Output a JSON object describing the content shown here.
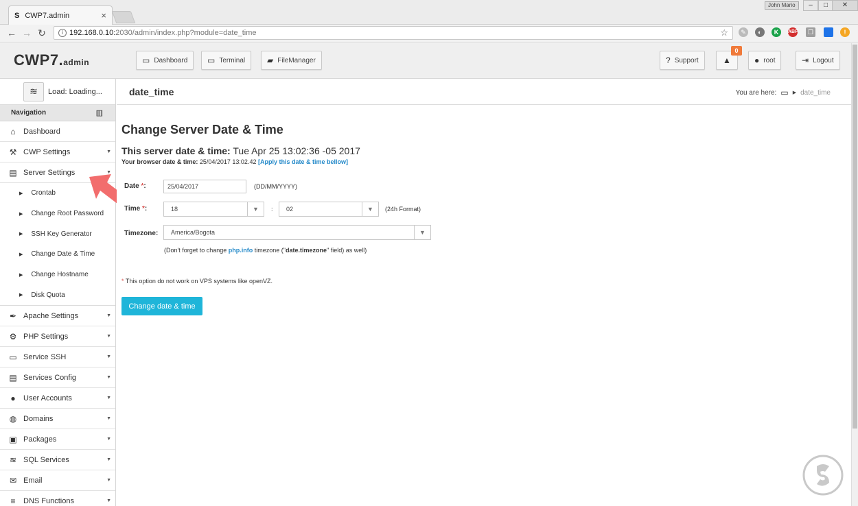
{
  "browser": {
    "tab_favicon": "S",
    "tab_title": "CWP7.admin",
    "tab_close": "×",
    "user_badge": "John Mario",
    "url_host": "192.168.0.10:",
    "url_path": "2030/admin/index.php?module=date_time",
    "window_controls": [
      "–",
      "□",
      "✕"
    ]
  },
  "header": {
    "logo_main": "CWP7.",
    "logo_sub": "admin",
    "buttons": {
      "dashboard": "Dashboard",
      "terminal": "Terminal",
      "filemanager": "FileManager",
      "support": "Support",
      "user": "root",
      "logout": "Logout"
    },
    "notification_count": "0"
  },
  "sidebar": {
    "load_text": "Load: Loading...",
    "nav_heading": "Navigation",
    "items": [
      {
        "label": "Dashboard",
        "icon": "home-icon",
        "glyph": "⌂"
      },
      {
        "label": "CWP Settings",
        "icon": "tools-icon",
        "glyph": "⚒"
      },
      {
        "label": "Server Settings",
        "icon": "server-icon",
        "glyph": "▤"
      }
    ],
    "subitems": [
      {
        "label": "Crontab"
      },
      {
        "label": "Change Root Password"
      },
      {
        "label": "SSH Key Generator"
      },
      {
        "label": "Change Date & Time"
      },
      {
        "label": "Change Hostname"
      },
      {
        "label": "Disk Quota"
      }
    ],
    "items_after": [
      {
        "label": "Apache Settings",
        "icon": "feather-icon",
        "glyph": "✒"
      },
      {
        "label": "PHP Settings",
        "icon": "gear-icon",
        "glyph": "⚙"
      },
      {
        "label": "Service SSH",
        "icon": "monitor-icon",
        "glyph": "▭"
      },
      {
        "label": "Services Config",
        "icon": "server-icon",
        "glyph": "▤"
      },
      {
        "label": "User Accounts",
        "icon": "user-icon",
        "glyph": "●"
      },
      {
        "label": "Domains",
        "icon": "globe-icon",
        "glyph": "◍"
      },
      {
        "label": "Packages",
        "icon": "packages-icon",
        "glyph": "▣"
      },
      {
        "label": "SQL Services",
        "icon": "database-icon",
        "glyph": "≋"
      },
      {
        "label": "Email",
        "icon": "email-icon",
        "glyph": "✉"
      },
      {
        "label": "DNS Functions",
        "icon": "dns-icon",
        "glyph": "≡"
      }
    ]
  },
  "page": {
    "module_title": "date_time",
    "breadcrumb_label": "You are here:",
    "breadcrumb_current": "date_time",
    "heading": "Change Server Date & Time",
    "server_label": "This server date & time:",
    "server_value": "Tue Apr 25 13:02:36 -05 2017",
    "browser_label": "Your browser date & time:",
    "browser_value": "25/04/2017 13:02.42",
    "apply_link": "[Apply this date & time bellow]",
    "form": {
      "date_label": "Date",
      "date_value": "25/04/2017",
      "date_hint": "(DD/MM/YYYY)",
      "time_label": "Time",
      "hour_value": "18",
      "minute_value": "02",
      "time_sep": ":",
      "time_hint": "(24h Format)",
      "timezone_label": "Timezone:",
      "timezone_value": "America/Bogota",
      "tz_hint_pre": "(Don't forget to change ",
      "tz_hint_link": "php.info",
      "tz_hint_mid": " timezone (\"",
      "tz_hint_bold": "date.timezone",
      "tz_hint_post": "\" field) as well)",
      "required_mark": "*",
      "colon": ":"
    },
    "footnote": "This option do not work on VPS systems like openVZ.",
    "submit_label": "Change date & time"
  },
  "colors": {
    "accent": "#1fb5d9",
    "link": "#2389c9",
    "required": "#d9534f",
    "notification": "#f07a3a",
    "pointer_arrow": "#f26d6d"
  }
}
